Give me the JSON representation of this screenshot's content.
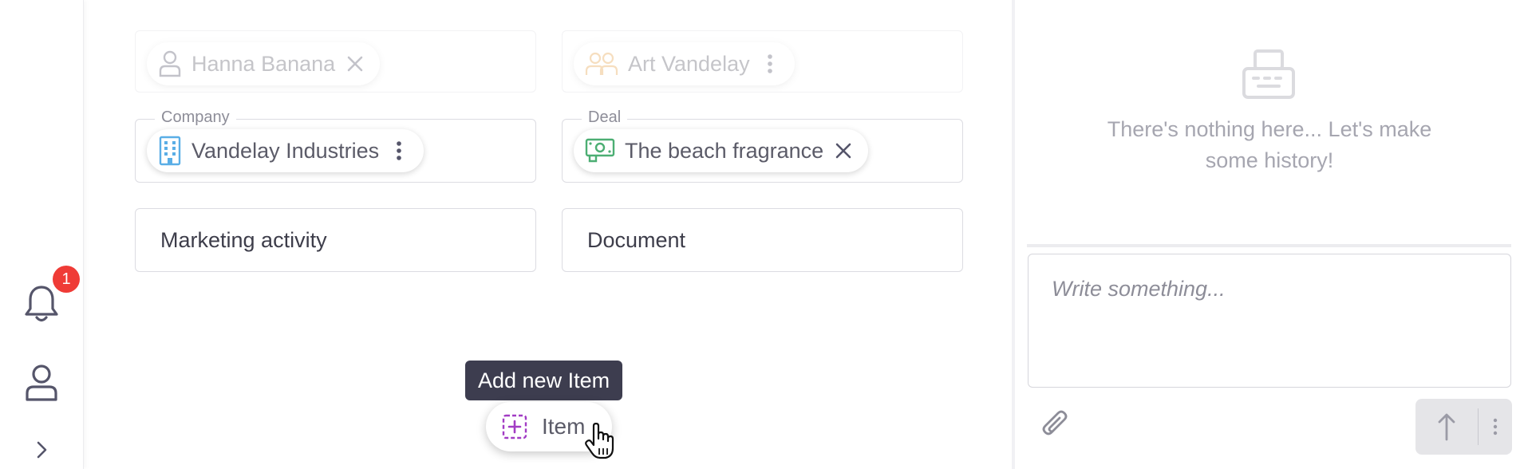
{
  "rail": {
    "notification_count": "1"
  },
  "fields": {
    "person_chip": "Hanna Banana",
    "team_chip": "Art Vandelay",
    "company_label": "Company",
    "company_chip": "Vandelay Industries",
    "deal_label": "Deal",
    "deal_chip": "The beach fragrance",
    "marketing_activity": "Marketing activity",
    "document": "Document"
  },
  "add_item": {
    "tooltip": "Add new Item",
    "label": "Item"
  },
  "panel": {
    "empty_text_line1": "There's nothing here... Let's make",
    "empty_text_line2": "some history!",
    "composer_placeholder": "Write something..."
  },
  "colors": {
    "badge": "#ef3b36",
    "tooltip_bg": "#3d3d4f",
    "add_icon": "#a23cc4",
    "company_icon": "#5aaee6",
    "deal_icon": "#4cae73"
  }
}
